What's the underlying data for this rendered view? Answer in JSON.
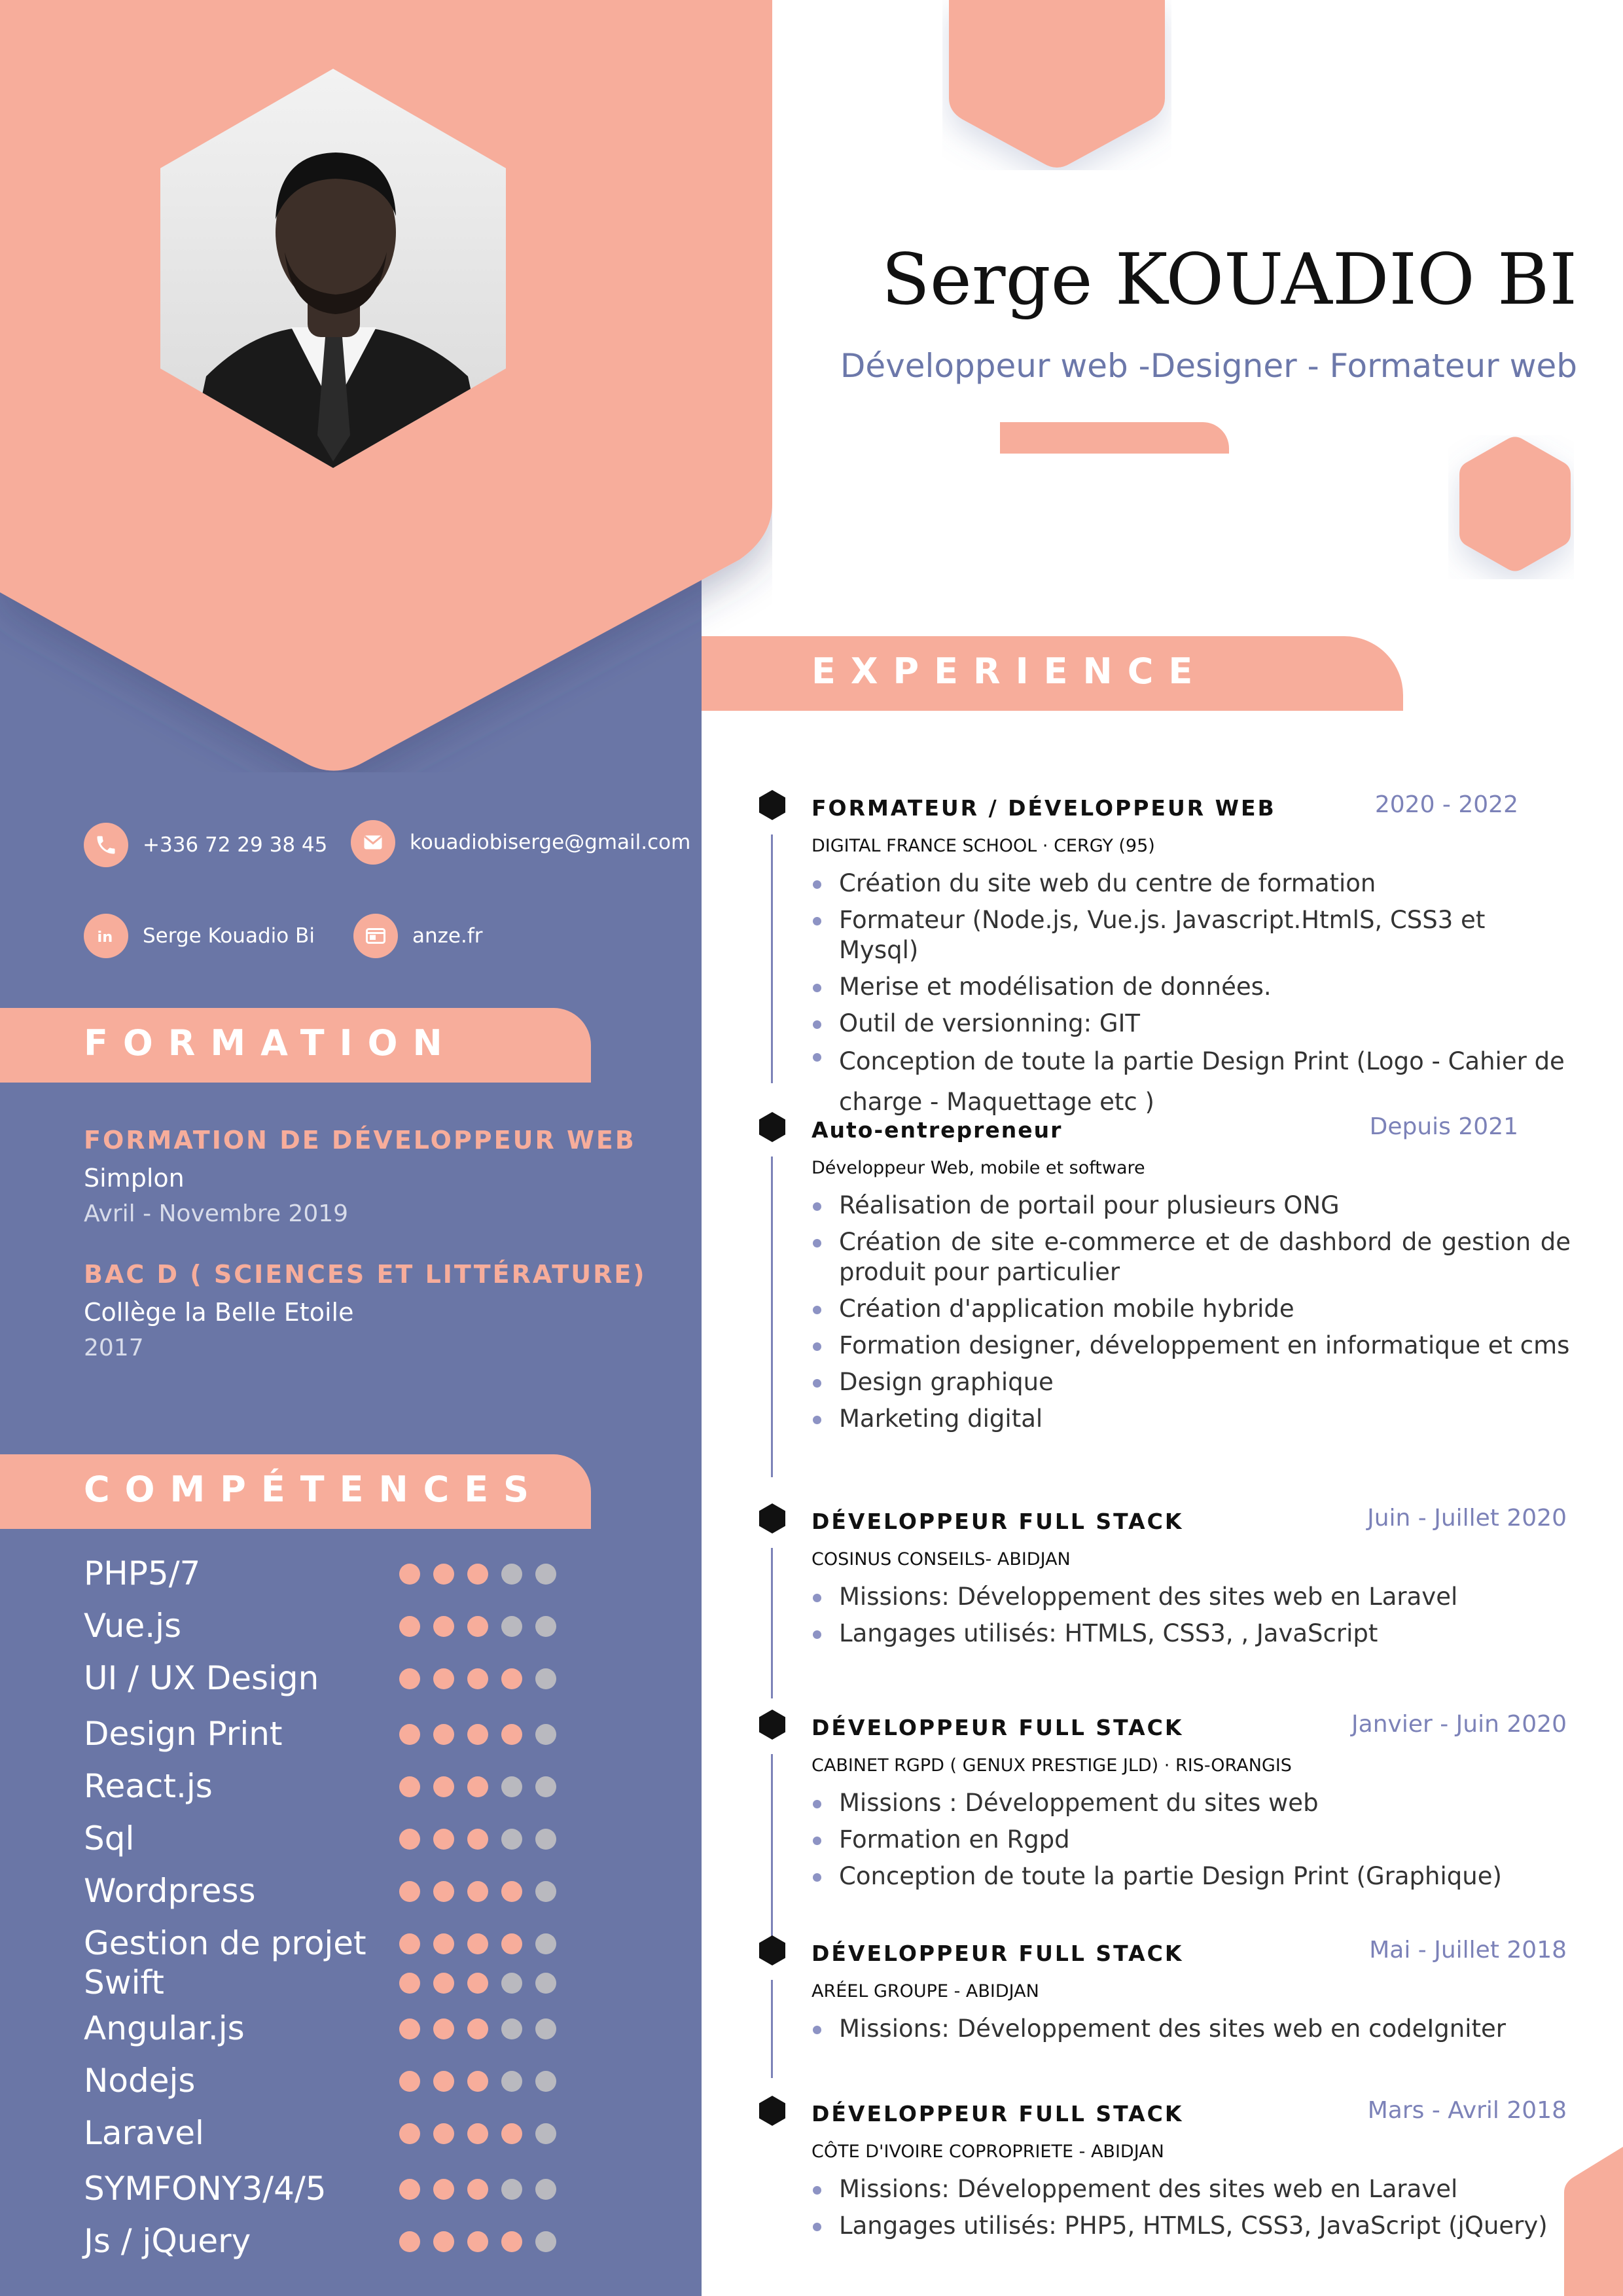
{
  "header": {
    "name": "Serge KOUADIO BI",
    "role": "Développeur web -Designer -  Formateur web"
  },
  "contacts": {
    "phone": "+336 72 29 38 45",
    "email": "kouadiobiserge@gmail.com",
    "linkedin": "Serge Kouadio Bi",
    "website": "anze.fr"
  },
  "formation": {
    "section_title": "FORMATION",
    "items": [
      {
        "title": "FORMATION DE DÉVELOPPEUR WEB",
        "school": "Simplon",
        "date": "Avril - Novembre 2019"
      },
      {
        "title": "BAC D ( SCIENCES ET LITTÉRATURE)",
        "school": "Collège la Belle Etoile",
        "date": "2017"
      }
    ]
  },
  "skills": {
    "section_title": "COMPÉTENCES",
    "scale_max": 5,
    "items": [
      {
        "name": "PHP5/7",
        "level": 3
      },
      {
        "name": "Vue.js",
        "level": 3
      },
      {
        "name": "UI / UX Design",
        "level": 4
      },
      {
        "name": "Design Print",
        "level": 4
      },
      {
        "name": "React.js",
        "level": 3
      },
      {
        "name": "Sql",
        "level": 3
      },
      {
        "name": "Wordpress",
        "level": 4
      },
      {
        "name": "Gestion de projet",
        "level": 4
      },
      {
        "name": "Swift",
        "level": 3
      },
      {
        "name": "Angular.js",
        "level": 3
      },
      {
        "name": "Nodejs",
        "level": 3
      },
      {
        "name": "Laravel",
        "level": 4
      },
      {
        "name": "SYMFONY3/4/5",
        "level": 3
      },
      {
        "name": "Js / jQuery",
        "level": 4
      }
    ]
  },
  "experience": {
    "section_title": "EXPERIENCE",
    "items": [
      {
        "title": "FORMATEUR / DÉVELOPPEUR WEB",
        "date": "2020 - 2022",
        "company": "DIGITAL FRANCE SCHOOL · CERGY (95)",
        "bullets": [
          "Création du site web du centre de formation",
          "Formateur (Node.js, Vue.js. Javascript.HtmlS, CSS3 et Mysql)",
          "Merise et modélisation de données.",
          "Outil de versionning: GIT",
          "Conception de toute la partie Design Print (Logo - Cahier de charge - Maquettage etc )"
        ]
      },
      {
        "title": "Auto-entrepreneur",
        "date": "Depuis 2021",
        "company": "Développeur Web, mobile et software",
        "bullets": [
          "Réalisation de portail pour plusieurs ONG",
          "Création de site e-commerce et de dashbord de gestion de produit pour particulier",
          "Création d'application mobile hybride",
          "Formation designer, développement en informatique et cms",
          "Design graphique",
          "Marketing digital"
        ]
      },
      {
        "title": "DÉVELOPPEUR FULL STACK",
        "date": "Juin - Juillet 2020",
        "company": "COSINUS CONSEILS- ABIDJAN",
        "bullets": [
          "Missions: Développement des sites web en Laravel",
          "Langages utilisés: HTMLS, CSS3, , JavaScript"
        ]
      },
      {
        "title": "DÉVELOPPEUR FULL STACK",
        "date": "Janvier - Juin 2020",
        "company": "CABINET RGPD ( GENUX PRESTIGE JLD) · RIS-ORANGIS",
        "bullets": [
          "Missions : Développement du sites web",
          "Formation en Rgpd",
          "Conception de toute la partie Design Print (Graphique)"
        ]
      },
      {
        "title": "DÉVELOPPEUR FULL STACK",
        "date": "Mai - Juillet 2018",
        "company": "ARÉEL GROUPE - ABIDJAN",
        "bullets": [
          "Missions: Développement des sites web en codeIgniter"
        ]
      },
      {
        "title": "DÉVELOPPEUR FULL STACK",
        "date": "Mars - Avril 2018",
        "company": "CÔTE D'IVOIRE COPROPRIETE -  ABIDJAN",
        "bullets": [
          "Missions: Développement des sites web en Laravel",
          "Langages utilisés: PHP5, HTMLS, CSS3,  JavaScript (jQuery)"
        ]
      }
    ]
  },
  "icons": {
    "phone": "phone-icon",
    "email": "envelope-icon",
    "linkedin": "linkedin-icon",
    "website": "browser-icon",
    "timeline_marker": "hexagon-icon"
  },
  "colors": {
    "salmon": "#f7ad9b",
    "slate_blue": "#6a76a6",
    "accent_text": "#7c82b8",
    "dot_off": "#b9b9bf"
  }
}
